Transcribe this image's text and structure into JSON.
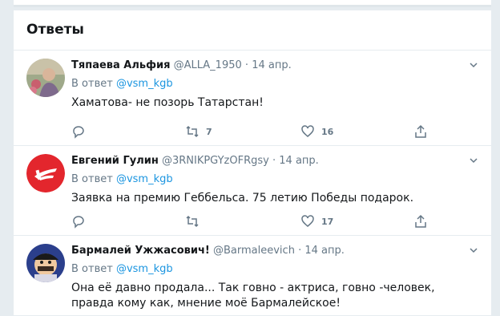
{
  "header": {
    "title": "Ответы"
  },
  "replies": [
    {
      "name": "Тяпаева Альфия",
      "handle": "@ALLA_1950",
      "date": "14 апр.",
      "reply_prefix": "В ответ",
      "reply_to": "@vsm_kgb",
      "text": "Хаматова- не позорь Татарстан!",
      "retweets": "7",
      "likes": "16",
      "avatar_icon": "person-photo-avatar"
    },
    {
      "name": "Евгений Гулин",
      "handle": "@3RNIKPGYzOFRgsy",
      "date": "14 апр.",
      "reply_prefix": "В ответ",
      "reply_to": "@vsm_kgb",
      "text": "Заявка на премию Геббельса. 75 летию Победы подарок.",
      "retweets": "",
      "likes": "17",
      "avatar_icon": "pobeda-logo-avatar",
      "avatar_color": "#e3262d"
    },
    {
      "name": "Бармалей Ужжасович!",
      "handle": "@Barmaleevich",
      "date": "14 апр.",
      "reply_prefix": "В ответ",
      "reply_to": "@vsm_kgb",
      "text": "Она её давно продала... Так говно - актриса, говно -человек, правда кому как, мнение моё Бармалейское!",
      "retweets": "",
      "likes": "",
      "avatar_icon": "cartoon-pirate-avatar"
    }
  ],
  "colors": {
    "accent": "#1b95e0",
    "muted": "#657786",
    "text": "#14171a",
    "border": "#e6ecf0"
  }
}
